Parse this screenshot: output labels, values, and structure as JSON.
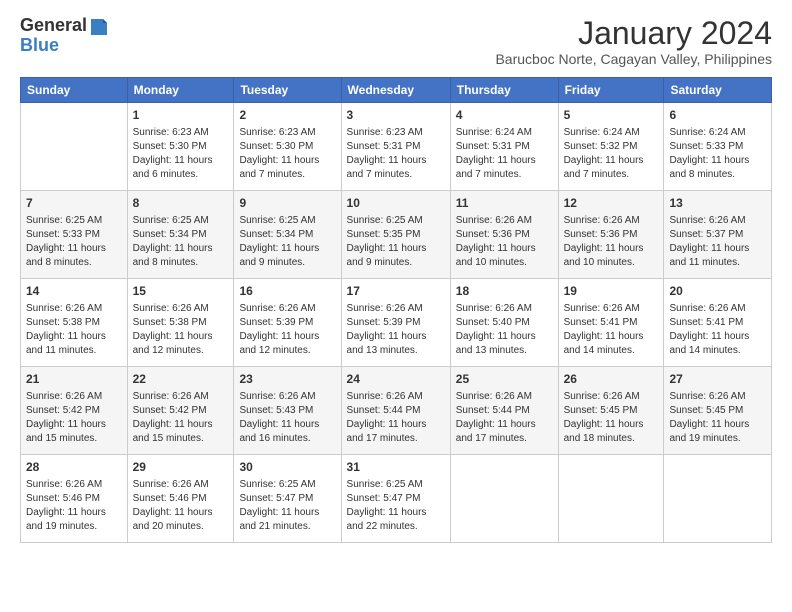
{
  "logo": {
    "line1": "General",
    "line2": "Blue"
  },
  "title": "January 2024",
  "subtitle": "Barucboc Norte, Cagayan Valley, Philippines",
  "weekdays": [
    "Sunday",
    "Monday",
    "Tuesday",
    "Wednesday",
    "Thursday",
    "Friday",
    "Saturday"
  ],
  "weeks": [
    [
      {
        "day": "",
        "sunrise": "",
        "sunset": "",
        "daylight": ""
      },
      {
        "day": "1",
        "sunrise": "Sunrise: 6:23 AM",
        "sunset": "Sunset: 5:30 PM",
        "daylight": "Daylight: 11 hours and 6 minutes."
      },
      {
        "day": "2",
        "sunrise": "Sunrise: 6:23 AM",
        "sunset": "Sunset: 5:30 PM",
        "daylight": "Daylight: 11 hours and 7 minutes."
      },
      {
        "day": "3",
        "sunrise": "Sunrise: 6:23 AM",
        "sunset": "Sunset: 5:31 PM",
        "daylight": "Daylight: 11 hours and 7 minutes."
      },
      {
        "day": "4",
        "sunrise": "Sunrise: 6:24 AM",
        "sunset": "Sunset: 5:31 PM",
        "daylight": "Daylight: 11 hours and 7 minutes."
      },
      {
        "day": "5",
        "sunrise": "Sunrise: 6:24 AM",
        "sunset": "Sunset: 5:32 PM",
        "daylight": "Daylight: 11 hours and 7 minutes."
      },
      {
        "day": "6",
        "sunrise": "Sunrise: 6:24 AM",
        "sunset": "Sunset: 5:33 PM",
        "daylight": "Daylight: 11 hours and 8 minutes."
      }
    ],
    [
      {
        "day": "7",
        "sunrise": "Sunrise: 6:25 AM",
        "sunset": "Sunset: 5:33 PM",
        "daylight": "Daylight: 11 hours and 8 minutes."
      },
      {
        "day": "8",
        "sunrise": "Sunrise: 6:25 AM",
        "sunset": "Sunset: 5:34 PM",
        "daylight": "Daylight: 11 hours and 8 minutes."
      },
      {
        "day": "9",
        "sunrise": "Sunrise: 6:25 AM",
        "sunset": "Sunset: 5:34 PM",
        "daylight": "Daylight: 11 hours and 9 minutes."
      },
      {
        "day": "10",
        "sunrise": "Sunrise: 6:25 AM",
        "sunset": "Sunset: 5:35 PM",
        "daylight": "Daylight: 11 hours and 9 minutes."
      },
      {
        "day": "11",
        "sunrise": "Sunrise: 6:26 AM",
        "sunset": "Sunset: 5:36 PM",
        "daylight": "Daylight: 11 hours and 10 minutes."
      },
      {
        "day": "12",
        "sunrise": "Sunrise: 6:26 AM",
        "sunset": "Sunset: 5:36 PM",
        "daylight": "Daylight: 11 hours and 10 minutes."
      },
      {
        "day": "13",
        "sunrise": "Sunrise: 6:26 AM",
        "sunset": "Sunset: 5:37 PM",
        "daylight": "Daylight: 11 hours and 11 minutes."
      }
    ],
    [
      {
        "day": "14",
        "sunrise": "Sunrise: 6:26 AM",
        "sunset": "Sunset: 5:38 PM",
        "daylight": "Daylight: 11 hours and 11 minutes."
      },
      {
        "day": "15",
        "sunrise": "Sunrise: 6:26 AM",
        "sunset": "Sunset: 5:38 PM",
        "daylight": "Daylight: 11 hours and 12 minutes."
      },
      {
        "day": "16",
        "sunrise": "Sunrise: 6:26 AM",
        "sunset": "Sunset: 5:39 PM",
        "daylight": "Daylight: 11 hours and 12 minutes."
      },
      {
        "day": "17",
        "sunrise": "Sunrise: 6:26 AM",
        "sunset": "Sunset: 5:39 PM",
        "daylight": "Daylight: 11 hours and 13 minutes."
      },
      {
        "day": "18",
        "sunrise": "Sunrise: 6:26 AM",
        "sunset": "Sunset: 5:40 PM",
        "daylight": "Daylight: 11 hours and 13 minutes."
      },
      {
        "day": "19",
        "sunrise": "Sunrise: 6:26 AM",
        "sunset": "Sunset: 5:41 PM",
        "daylight": "Daylight: 11 hours and 14 minutes."
      },
      {
        "day": "20",
        "sunrise": "Sunrise: 6:26 AM",
        "sunset": "Sunset: 5:41 PM",
        "daylight": "Daylight: 11 hours and 14 minutes."
      }
    ],
    [
      {
        "day": "21",
        "sunrise": "Sunrise: 6:26 AM",
        "sunset": "Sunset: 5:42 PM",
        "daylight": "Daylight: 11 hours and 15 minutes."
      },
      {
        "day": "22",
        "sunrise": "Sunrise: 6:26 AM",
        "sunset": "Sunset: 5:42 PM",
        "daylight": "Daylight: 11 hours and 15 minutes."
      },
      {
        "day": "23",
        "sunrise": "Sunrise: 6:26 AM",
        "sunset": "Sunset: 5:43 PM",
        "daylight": "Daylight: 11 hours and 16 minutes."
      },
      {
        "day": "24",
        "sunrise": "Sunrise: 6:26 AM",
        "sunset": "Sunset: 5:44 PM",
        "daylight": "Daylight: 11 hours and 17 minutes."
      },
      {
        "day": "25",
        "sunrise": "Sunrise: 6:26 AM",
        "sunset": "Sunset: 5:44 PM",
        "daylight": "Daylight: 11 hours and 17 minutes."
      },
      {
        "day": "26",
        "sunrise": "Sunrise: 6:26 AM",
        "sunset": "Sunset: 5:45 PM",
        "daylight": "Daylight: 11 hours and 18 minutes."
      },
      {
        "day": "27",
        "sunrise": "Sunrise: 6:26 AM",
        "sunset": "Sunset: 5:45 PM",
        "daylight": "Daylight: 11 hours and 19 minutes."
      }
    ],
    [
      {
        "day": "28",
        "sunrise": "Sunrise: 6:26 AM",
        "sunset": "Sunset: 5:46 PM",
        "daylight": "Daylight: 11 hours and 19 minutes."
      },
      {
        "day": "29",
        "sunrise": "Sunrise: 6:26 AM",
        "sunset": "Sunset: 5:46 PM",
        "daylight": "Daylight: 11 hours and 20 minutes."
      },
      {
        "day": "30",
        "sunrise": "Sunrise: 6:25 AM",
        "sunset": "Sunset: 5:47 PM",
        "daylight": "Daylight: 11 hours and 21 minutes."
      },
      {
        "day": "31",
        "sunrise": "Sunrise: 6:25 AM",
        "sunset": "Sunset: 5:47 PM",
        "daylight": "Daylight: 11 hours and 22 minutes."
      },
      {
        "day": "",
        "sunrise": "",
        "sunset": "",
        "daylight": ""
      },
      {
        "day": "",
        "sunrise": "",
        "sunset": "",
        "daylight": ""
      },
      {
        "day": "",
        "sunrise": "",
        "sunset": "",
        "daylight": ""
      }
    ]
  ]
}
